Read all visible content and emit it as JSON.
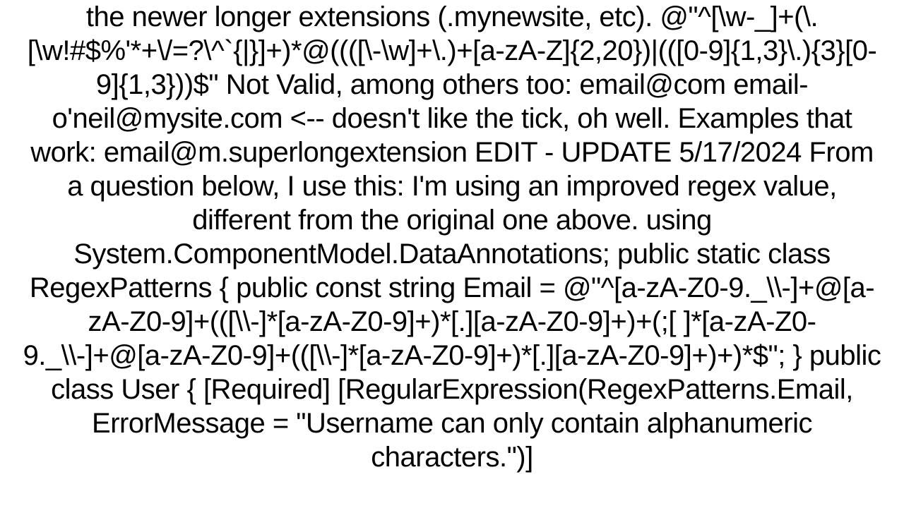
{
  "document": {
    "body_text": "the newer longer extensions (.mynewsite, etc). @\"^[\\w-_]+(\\.[\\w!#$%'*+\\/=?\\^`{|}]+)*@((([\\-\\w]+\\.)+[a-zA-Z]{2,20})|(([0-9]{1,3}\\.){3}[0-9]{1,3}))$\"  Not Valid, among others too:  email@com email-o'neil@mysite.com  <-- doesn't like the tick, oh well.  Examples that work: email@m.superlongextension  EDIT - UPDATE 5/17/2024 From a question below, I use this: I'm using an improved regex value, different from the original one above. using System.ComponentModel.DataAnnotations;      public static class RegexPatterns     {         public const string Email = @\"^[a-zA-Z0-9._\\\\-]+@[a-zA-Z0-9]+(([\\\\-]*[a-zA-Z0-9]+)*[.][a-zA-Z0-9]+)+(;[ ]*[a-zA-Z0-9._\\\\-]+@[a-zA-Z0-9]+(([\\\\-]*[a-zA-Z0-9]+)*[.][a-zA-Z0-9]+)+)*$\";     } public class User {     [Required]     [RegularExpression(RegexPatterns.Email, ErrorMessage = \"Username can only contain alphanumeric characters.\")]"
  }
}
